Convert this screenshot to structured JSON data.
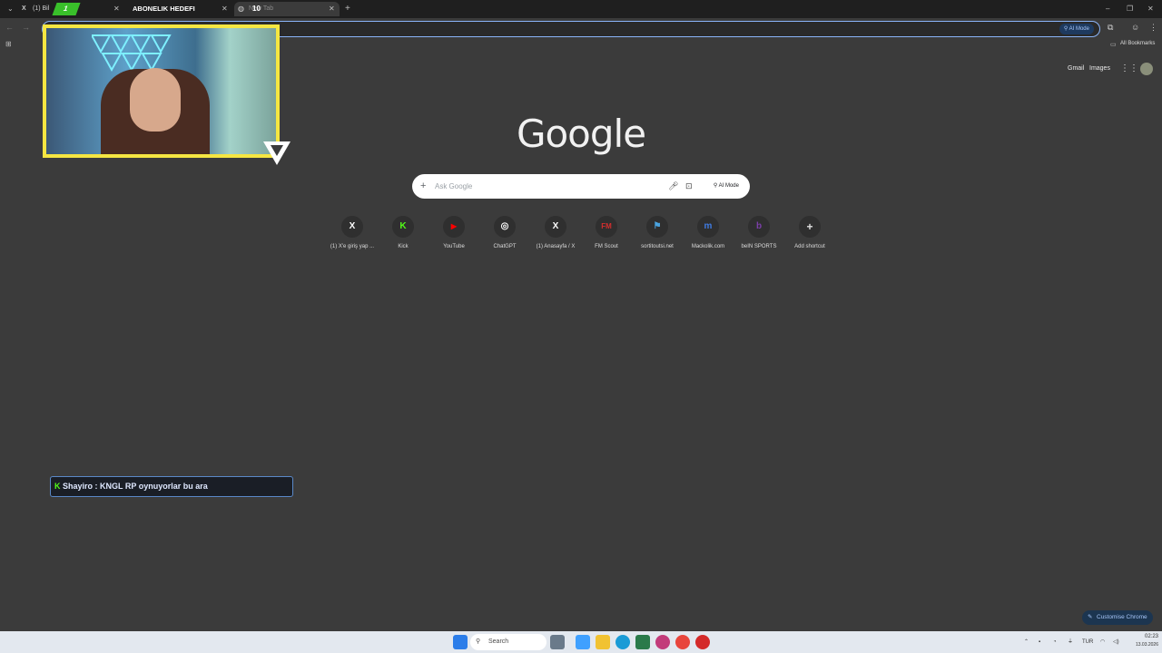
{
  "tabs": [
    {
      "label": "(1) Bil",
      "active": false
    },
    {
      "label": "ABONELIK HEDEFI",
      "active": false
    },
    {
      "label": "New Tab",
      "active": true
    }
  ],
  "tab_overlay_numbers": {
    "left": "1",
    "right": "10"
  },
  "new_tab_symbol": "+",
  "window_controls": {
    "minimize": "–",
    "restore": "❐",
    "close": "✕"
  },
  "toolbar": {
    "ai_mode_label": "AI Mode"
  },
  "bookmarks": {
    "all_bookmarks_label": "All Bookmarks"
  },
  "header_links": {
    "gmail": "Gmail",
    "images": "Images"
  },
  "google_logo": "Google",
  "search": {
    "placeholder": "Ask Google",
    "ai_mode_label": "AI Mode"
  },
  "shortcuts": [
    {
      "label": "(1) X'e giriş yap ...",
      "icon": "X",
      "color": "#ffffff"
    },
    {
      "label": "Kick",
      "icon": "K",
      "color": "#53fc18"
    },
    {
      "label": "YouTube",
      "icon": "▶",
      "color": "#ff0000"
    },
    {
      "label": "ChatGPT",
      "icon": "◎",
      "color": "#ffffff"
    },
    {
      "label": "(1) Anasayfa / X",
      "icon": "X",
      "color": "#ffffff"
    },
    {
      "label": "FM Scout",
      "icon": "FM",
      "color": "#d32f2f"
    },
    {
      "label": "sortitoutsi.net",
      "icon": "⚑",
      "color": "#4aa3df"
    },
    {
      "label": "Mackolik.com",
      "icon": "m",
      "color": "#3f7be0"
    },
    {
      "label": "beIN SPORTS",
      "icon": "b",
      "color": "#7b3fa8"
    },
    {
      "label": "Add shortcut",
      "icon": "+",
      "color": "#e0e0e0"
    }
  ],
  "chat_overlay": {
    "text": "Shayiro : KNGL RP oynuyorlar bu ara"
  },
  "customise_label": "Customise Chrome",
  "taskbar": {
    "search_label": "Search",
    "language": "TUR",
    "time": "02:23",
    "date": "13.03.2026"
  }
}
